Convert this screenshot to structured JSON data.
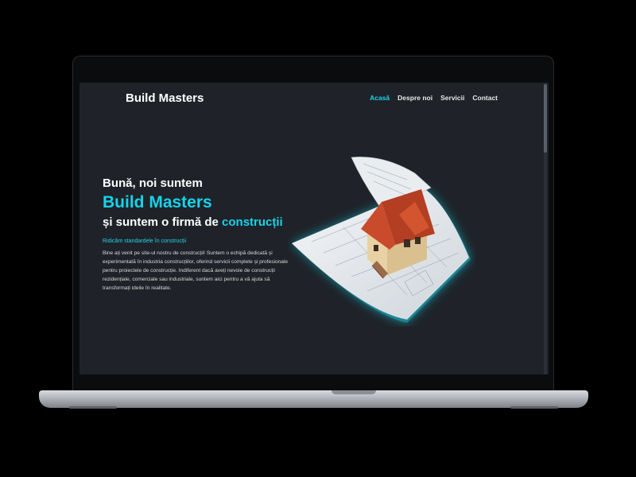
{
  "site": {
    "brand": "Build Masters",
    "nav": [
      "Acasă",
      "Despre noi",
      "Servicii",
      "Contact"
    ],
    "active_nav": "Acasă"
  },
  "hero": {
    "greeting": "Bună, noi suntem",
    "title": "Build Masters",
    "subtitle_prefix": "și suntem o firmă de ",
    "subtitle_highlight": "construcții",
    "tagline": "Ridicăm standardele în construcții",
    "paragraph": "Bine ați venit pe site-ul nostru de construcții! Suntem o echipă dedicată și experimentată în industria construcțiilor, oferind servicii complete și profesionale pentru proiectele de construcție. Indiferent dacă aveți nevoie de construcții rezidențiale, comerciale sau industriale, suntem aici pentru a vă ajuta să transformați ideile în realitate."
  },
  "colors": {
    "accent": "#18d3ea",
    "background": "#1f2329",
    "roof": "#c94b2c",
    "walls": "#e8d2a4"
  },
  "icons": [
    "house-blueprint-illustration"
  ]
}
